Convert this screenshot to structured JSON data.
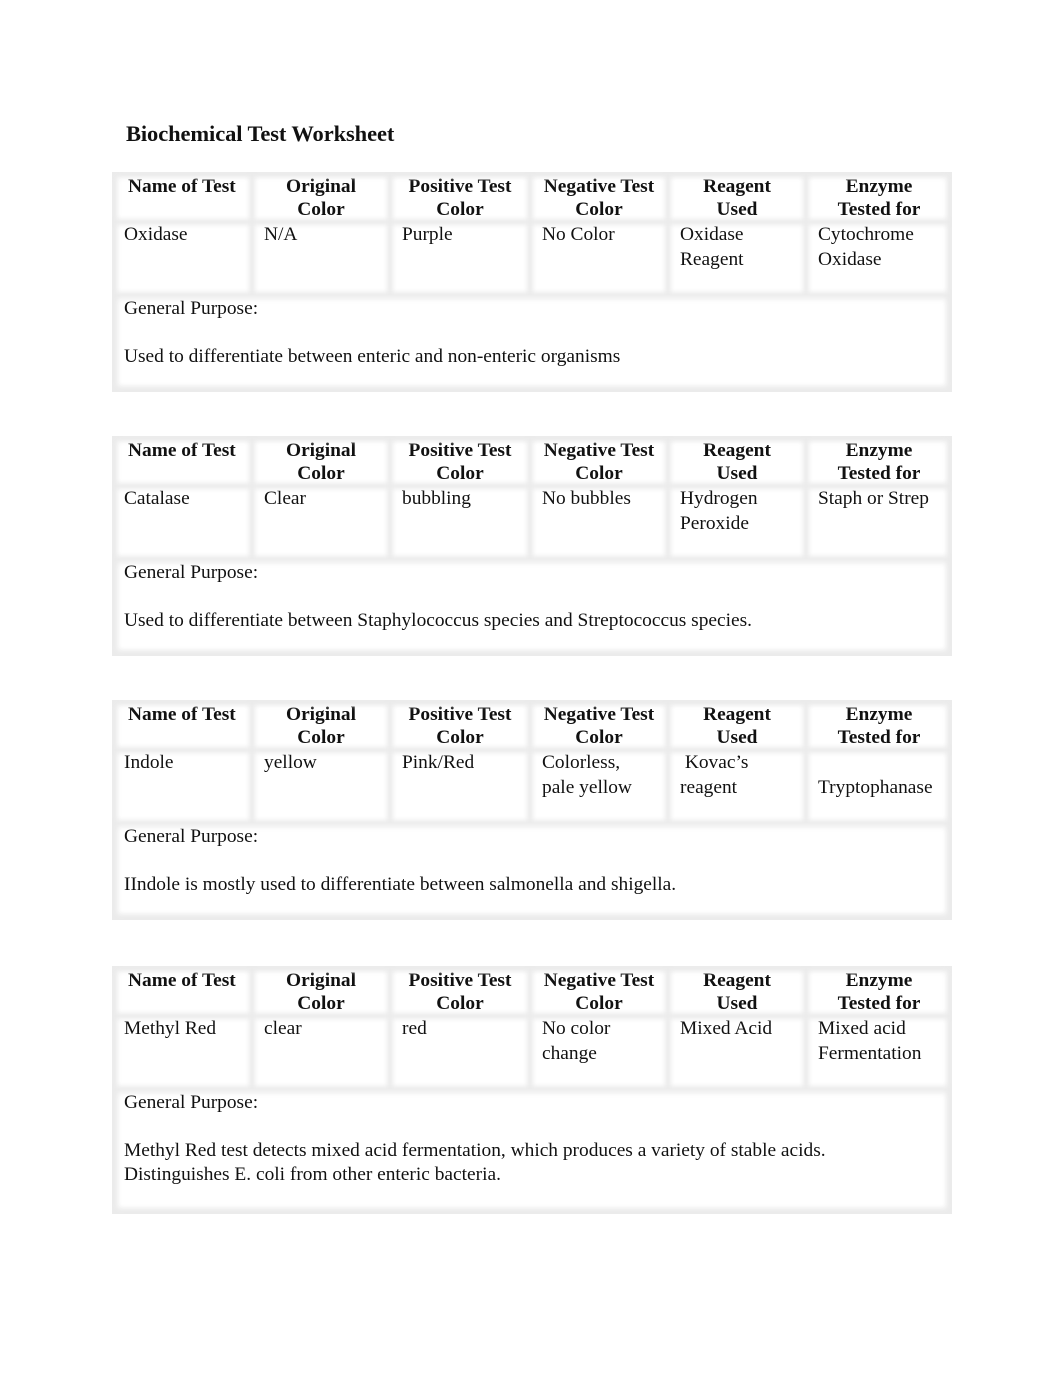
{
  "document": {
    "title": "Biochemical Test Worksheet"
  },
  "columns": [
    "Name of Test",
    "Original Color",
    "Positive Test Color",
    "Negative Test Color",
    "Reagent Used",
    "Enzyme Tested for"
  ],
  "column_lines": [
    [
      "Name of Test",
      ""
    ],
    [
      "Original",
      "Color"
    ],
    [
      "Positive Test",
      "Color"
    ],
    [
      "Negative Test",
      "Color"
    ],
    [
      "Reagent",
      "Used"
    ],
    [
      "Enzyme",
      "Tested for"
    ]
  ],
  "purpose_label": "General Purpose:",
  "tests": [
    {
      "name": "Oxidase",
      "original_color": "N/A",
      "positive_color": "Purple",
      "negative_color": "No Color",
      "reagent": "Oxidase\nReagent",
      "enzyme": "Cytochrome\nOxidase",
      "purpose": "Used to differentiate between enteric and non-enteric organisms"
    },
    {
      "name": "Catalase",
      "original_color": "Clear",
      "positive_color": "bubbling",
      "negative_color": "No bubbles",
      "reagent": "Hydrogen\nPeroxide",
      "enzyme": "Staph or Strep",
      "purpose": "Used to differentiate between Staphylococcus species and Streptococcus species."
    },
    {
      "name": "Indole",
      "original_color": "yellow",
      "positive_color": "Pink/Red",
      "negative_color": "Colorless,\npale yellow",
      "reagent": " Kovac’s\nreagent",
      "enzyme": "\nTryptophanase",
      "purpose": "IIndole is mostly used to differentiate between salmonella and shigella."
    },
    {
      "name": "Methyl Red",
      "original_color": "clear",
      "positive_color": "red",
      "negative_color": "No color\nchange",
      "reagent": "Mixed Acid",
      "enzyme": "Mixed acid\nFermentation",
      "purpose": "Methyl Red test detects mixed acid fermentation, which produces a variety of stable acids.\nDistinguishes E. coli from other enteric bacteria."
    }
  ]
}
